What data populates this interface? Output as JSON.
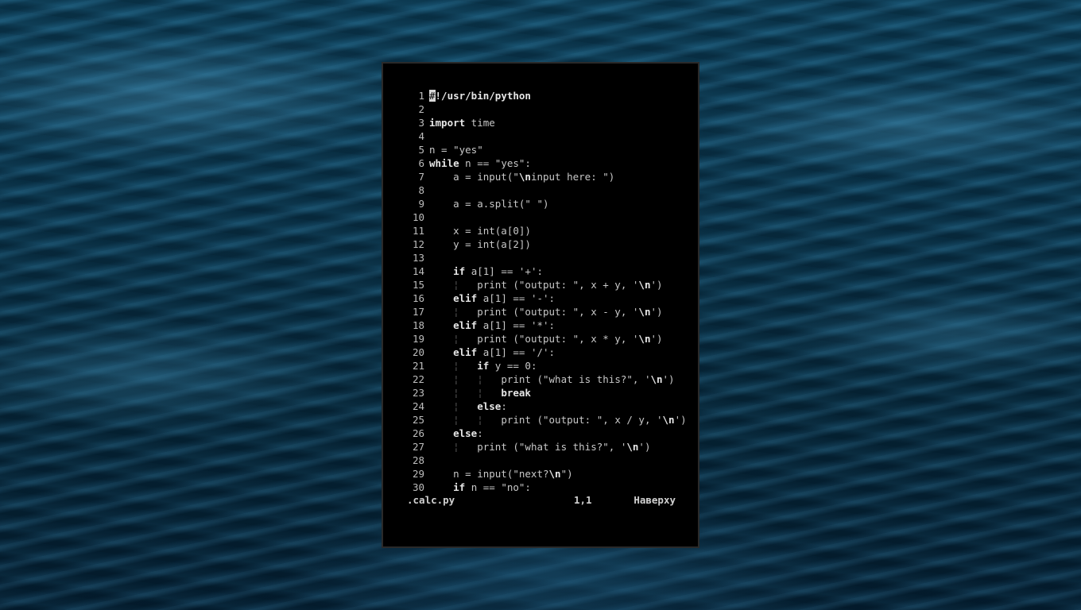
{
  "editor": {
    "lines": [
      {
        "n": "1",
        "t": "#!/usr/bin/python"
      },
      {
        "n": "2",
        "t": ""
      },
      {
        "n": "3",
        "t": "import time"
      },
      {
        "n": "4",
        "t": ""
      },
      {
        "n": "5",
        "t": "n = \"yes\""
      },
      {
        "n": "6",
        "t": "while n == \"yes\":"
      },
      {
        "n": "7",
        "t": "    a = input(\"\\ninput here: \")"
      },
      {
        "n": "8",
        "t": ""
      },
      {
        "n": "9",
        "t": "    a = a.split(\" \")"
      },
      {
        "n": "10",
        "t": ""
      },
      {
        "n": "11",
        "t": "    x = int(a[0])"
      },
      {
        "n": "12",
        "t": "    y = int(a[2])"
      },
      {
        "n": "13",
        "t": ""
      },
      {
        "n": "14",
        "t": "    if a[1] == '+':"
      },
      {
        "n": "15",
        "t": "    ¦   print (\"output: \", x + y, '\\n')"
      },
      {
        "n": "16",
        "t": "    elif a[1] == '-':"
      },
      {
        "n": "17",
        "t": "    ¦   print (\"output: \", x - y, '\\n')"
      },
      {
        "n": "18",
        "t": "    elif a[1] == '*':"
      },
      {
        "n": "19",
        "t": "    ¦   print (\"output: \", x * y, '\\n')"
      },
      {
        "n": "20",
        "t": "    elif a[1] == '/':"
      },
      {
        "n": "21",
        "t": "    ¦   if y == 0:"
      },
      {
        "n": "22",
        "t": "    ¦   ¦   print (\"what is this?\", '\\n')"
      },
      {
        "n": "23",
        "t": "    ¦   ¦   break"
      },
      {
        "n": "24",
        "t": "    ¦   else:"
      },
      {
        "n": "25",
        "t": "    ¦   ¦   print (\"output: \", x / y, '\\n')"
      },
      {
        "n": "26",
        "t": "    else:"
      },
      {
        "n": "27",
        "t": "    ¦   print (\"what is this?\", '\\n')"
      },
      {
        "n": "28",
        "t": ""
      },
      {
        "n": "29",
        "t": "    n = input(\"next?\\n\")"
      },
      {
        "n": "30",
        "t": "    if n == \"no\":"
      }
    ]
  },
  "statusline": {
    "filename": ".calc.py",
    "position": "1,1",
    "scroll": "Наверху"
  }
}
